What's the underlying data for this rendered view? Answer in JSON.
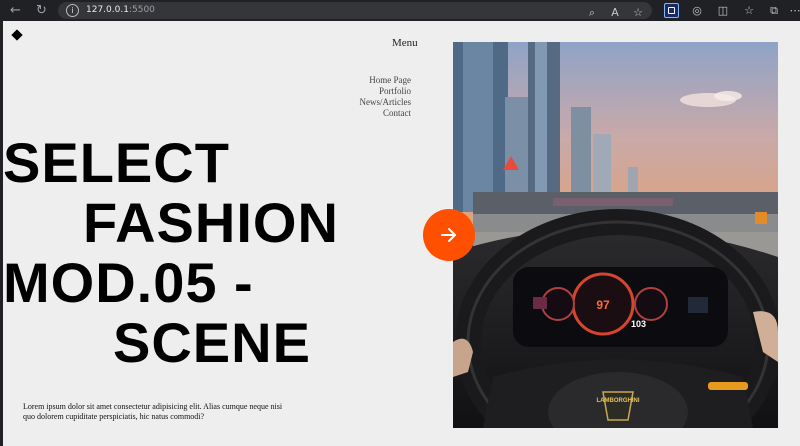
{
  "browser": {
    "url_host": "127.0.0.1",
    "url_port": ":5500",
    "icons": [
      "back-icon",
      "reload-icon",
      "info-icon",
      "zoom-icon",
      "read-aloud-icon",
      "favorite-star-icon",
      "extension-icon",
      "copilot-icon",
      "split-screen-icon",
      "favorites-icon",
      "collections-icon",
      "more-icon"
    ]
  },
  "nav": {
    "menu_label": "Menu",
    "items": [
      "Home Page",
      "Portfolio",
      "News/Articles",
      "Contact"
    ]
  },
  "hero": {
    "line1": "SELECT",
    "line2": "FASHION",
    "line3": "MOD.05 -",
    "line4": "SCENE"
  },
  "description": "Lorem ipsum dolor sit amet consectetur adipisicing elit. Alias cumque neque nisi quo dolorem cupiditate perspiciatis, hic natus commodi?",
  "scene": {
    "dashboard_speed": "103",
    "badge": "LAMBORGHINI"
  },
  "colors": {
    "accent": "#ff4f00",
    "page_bg": "#eeeeee",
    "text": "#000000"
  }
}
